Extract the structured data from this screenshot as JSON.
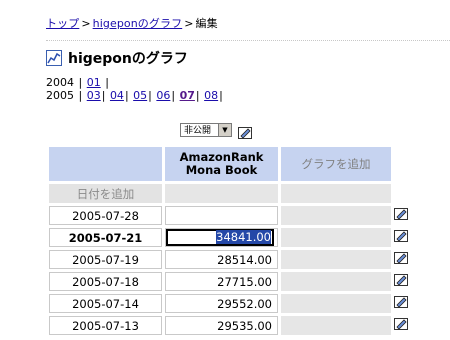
{
  "breadcrumb": {
    "home": "トップ",
    "graph": "higeponのグラフ",
    "current": "編集",
    "sep": ">"
  },
  "title": "higeponのグラフ",
  "months": [
    {
      "year": "2004",
      "items": [
        "01"
      ]
    },
    {
      "year": "2005",
      "items": [
        "03",
        "04",
        "05",
        "06",
        "07",
        "08"
      ],
      "current": "07"
    }
  ],
  "visibility": {
    "value": "非公開"
  },
  "table": {
    "column_header": "AmazonRank\nMona Book",
    "add_column_label": "グラフを追加",
    "add_date_label": "日付を追加",
    "rows": [
      {
        "date": "2005-07-28",
        "value": ""
      },
      {
        "date": "2005-07-21",
        "value": "34841.00",
        "selected": true
      },
      {
        "date": "2005-07-19",
        "value": "28514.00"
      },
      {
        "date": "2005-07-18",
        "value": "27715.00"
      },
      {
        "date": "2005-07-14",
        "value": "29552.00"
      },
      {
        "date": "2005-07-13",
        "value": "29535.00"
      }
    ]
  },
  "colors": {
    "header_bg": "#c6d3f0",
    "link": "#1a0dab",
    "visited": "#551a8b",
    "selection": "#2448a8"
  },
  "icons": {
    "title": "graph-icon",
    "edit": "edit-pencil-icon"
  }
}
